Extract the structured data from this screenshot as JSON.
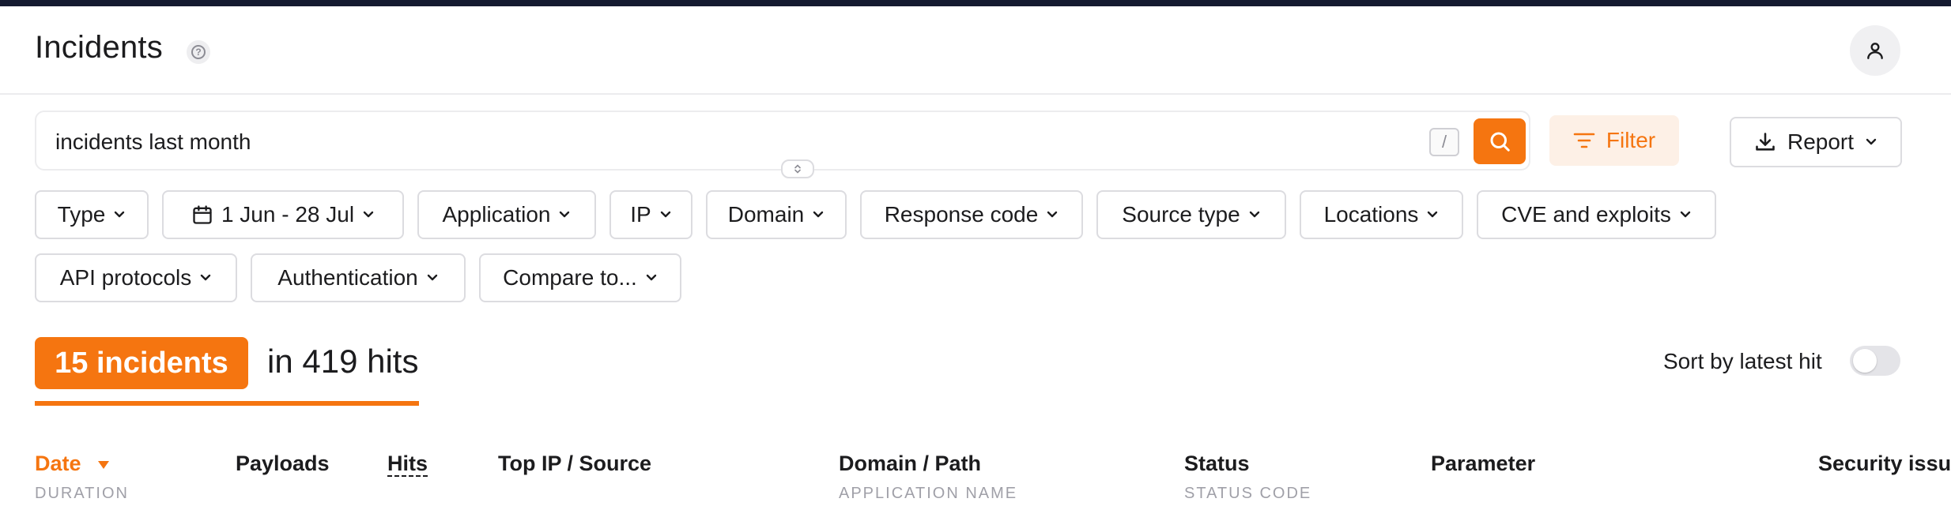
{
  "header": {
    "title": "Incidents",
    "help_icon": "question-circle-icon",
    "avatar_icon": "user-icon"
  },
  "search": {
    "value": "incidents last month",
    "placeholder": "",
    "shortcut_key": "/",
    "search_icon": "magnifier-icon"
  },
  "actions": {
    "filter_label": "Filter",
    "report_label": "Report"
  },
  "filters": [
    {
      "label": "Type"
    },
    {
      "label": "1 Jun - 28 Jul",
      "icon": "calendar-icon"
    },
    {
      "label": "Application"
    },
    {
      "label": "IP"
    },
    {
      "label": "Domain"
    },
    {
      "label": "Response code"
    },
    {
      "label": "Source type"
    },
    {
      "label": "Locations"
    },
    {
      "label": "CVE and exploits"
    },
    {
      "label": "API protocols"
    },
    {
      "label": "Authentication"
    },
    {
      "label": "Compare to..."
    }
  ],
  "summary": {
    "incidents_label": "15 incidents",
    "hits_label": "in 419 hits",
    "sort_label": "Sort by latest hit",
    "sort_enabled": false
  },
  "table": {
    "columns": [
      {
        "label": "Date",
        "sub": "DURATION",
        "sorted": "desc"
      },
      {
        "label": "Payloads",
        "sub": ""
      },
      {
        "label": "Hits",
        "sub": ""
      },
      {
        "label": "Top IP / Source",
        "sub": ""
      },
      {
        "label": "Domain / Path",
        "sub": "APPLICATION NAME"
      },
      {
        "label": "Status",
        "sub": "STATUS CODE"
      },
      {
        "label": "Parameter",
        "sub": ""
      },
      {
        "label": "Security issue",
        "sub": ""
      }
    ]
  },
  "colors": {
    "accent": "#f57510",
    "accent_soft": "#fdf0e6",
    "topbar": "#141a30",
    "border": "#dcdce0"
  }
}
